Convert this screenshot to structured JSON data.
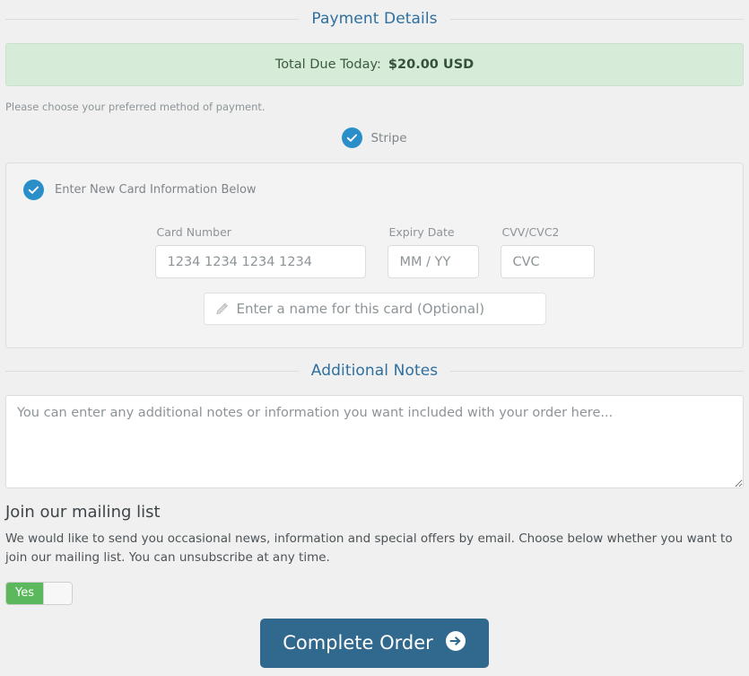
{
  "payment_section": {
    "heading": "Payment Details",
    "total": {
      "label": "Total Due Today:",
      "amount": "$20.00 USD"
    },
    "choose_method_text": "Please choose your preferred method of payment.",
    "gateways": [
      {
        "label": "Stripe",
        "selected": true,
        "icon": "check-circle-icon"
      }
    ]
  },
  "card_panel": {
    "header_label": "Enter New Card Information Below",
    "header_icon": "check-circle-icon",
    "fields": [
      {
        "label": "Card Number",
        "placeholder": "1234 1234 1234 1234",
        "value": ""
      },
      {
        "label": "Expiry Date",
        "placeholder": "MM / YY",
        "value": ""
      },
      {
        "label": "CVV/CVC2",
        "placeholder": "CVC",
        "value": ""
      }
    ],
    "card_name": {
      "placeholder": "Enter a name for this card (Optional)",
      "value": "",
      "icon": "pencil-icon"
    }
  },
  "notes_section": {
    "heading": "Additional Notes",
    "placeholder": "You can enter any additional notes or information you want included with your order here...",
    "value": ""
  },
  "mailing_list": {
    "title": "Join our mailing list",
    "description": "We would like to send you occasional news, information and special offers by email. Choose below whether you want to join our mailing list. You can unsubscribe at any time.",
    "toggle": {
      "state_label": "Yes",
      "on": true
    }
  },
  "submit": {
    "label": "Complete Order",
    "icon": "arrow-right-circle-icon"
  },
  "colors": {
    "page_background": "#f0f0f0",
    "heading_blue": "#2f6f9f",
    "banner_green_bg": "#d6ecd9",
    "banner_green_border": "#c7e3cc",
    "radio_blue": "#2a8fc9",
    "toggle_green": "#5cb85c",
    "submit_blue": "#31688e",
    "muted_text": "#8d9498"
  }
}
